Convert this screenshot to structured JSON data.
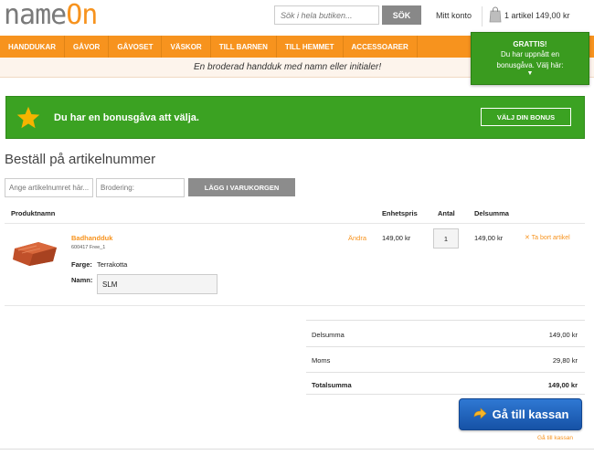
{
  "header": {
    "logo_main": "name",
    "logo_accent": "On",
    "search_placeholder": "Sök i hela butiken...",
    "search_button": "SÖK",
    "account_link": "Mitt konto",
    "cart_summary": "1 artikel 149,00 kr"
  },
  "nav": {
    "items": [
      "HANDDUKAR",
      "GÅVOR",
      "GÅVOSET",
      "VÄSKOR",
      "TILL BARNEN",
      "TILL HEMMET",
      "ACCESSOARER"
    ],
    "tagline": "En broderad handduk med namn eller initialer!"
  },
  "popup": {
    "title": "GRATTIS!",
    "line1": "Du har uppnått en",
    "line2": "bonusgåva. Välj här:"
  },
  "banner": {
    "text": "Du har en bonusgåva att välja.",
    "button": "VÄLJ DIN BONUS"
  },
  "order_by_article": {
    "title": "Beställ på artikelnummer",
    "article_placeholder": "Ange artikelnumret här...",
    "embroidery_placeholder": "Brodering:",
    "add_button": "LÄGG I VARUKORGEN"
  },
  "cart_table": {
    "headers": {
      "product": "Produktnamn",
      "unit_price": "Enhetspris",
      "qty": "Antal",
      "subtotal": "Delsumma"
    },
    "items": [
      {
        "name": "Badhandduk",
        "sku": "600417 Free_1",
        "color_label": "Farge:",
        "color": "Terrakotta",
        "name_label": "Namn:",
        "name_value": "SLM",
        "edit": "Ändra",
        "unit_price": "149,00 kr",
        "qty": "1",
        "subtotal": "149,00 kr",
        "remove": "✕ Ta bort artikel"
      }
    ]
  },
  "totals": {
    "subtotal_label": "Delsumma",
    "subtotal_value": "149,00 kr",
    "tax_label": "Moms",
    "tax_value": "29,80 kr",
    "total_label": "Totalsumma",
    "total_value": "149,00 kr"
  },
  "checkout": {
    "button": "Gå till kassan",
    "link": "Gå till kassan"
  },
  "colors": {
    "brand_orange": "#f7931e",
    "bonus_green": "#3ba222",
    "checkout_blue": "#1f64bf"
  }
}
